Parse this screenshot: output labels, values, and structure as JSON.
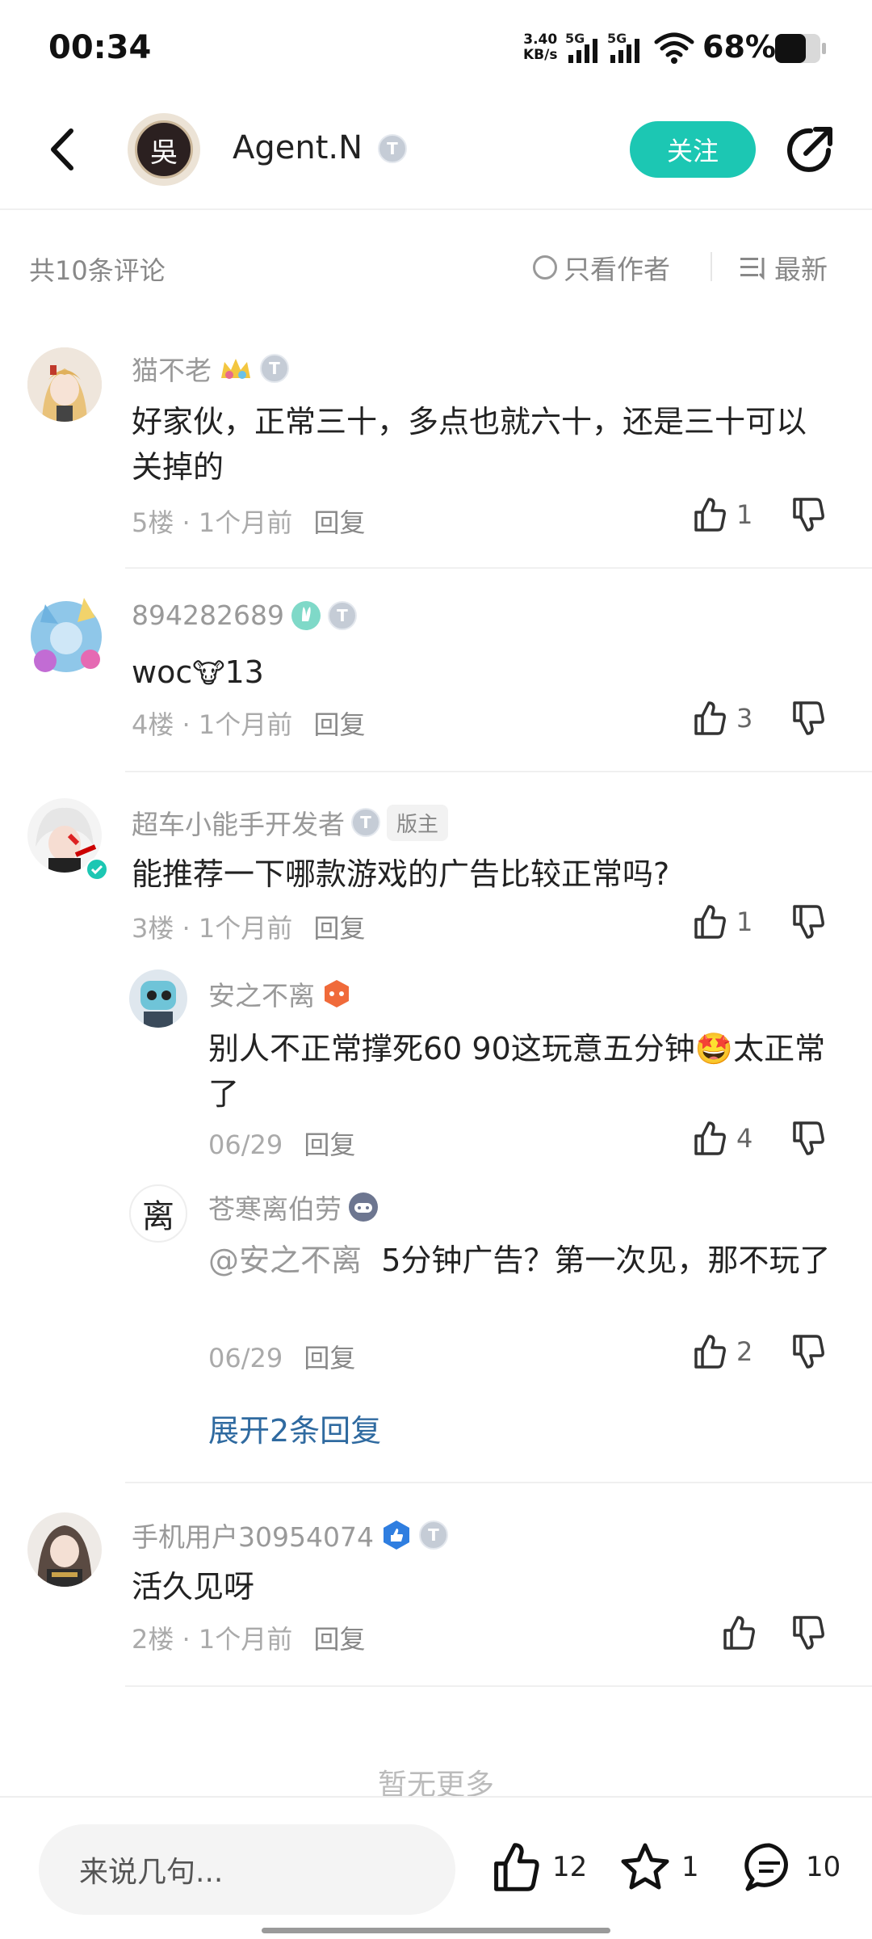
{
  "status_bar": {
    "time": "00:34",
    "net_speed_value": "3.40",
    "net_speed_unit": "KB/s",
    "signal1_label": "5G",
    "signal2_label": "5G",
    "battery": "68%"
  },
  "header": {
    "author_name": "Agent.N",
    "author_avatar_char": "吳",
    "author_level": "T",
    "follow_label": "关注"
  },
  "filter": {
    "count_label": "共10条评论",
    "author_only_label": "只看作者",
    "sort_label": "最新"
  },
  "comments": [
    {
      "name": "猫不老",
      "level": "T",
      "text": "好家伙，正常三十，多点也就六十，还是三十可以关掉的",
      "floor": "5楼",
      "time": "1个月前",
      "reply_label": "回复",
      "likes": "1"
    },
    {
      "name": "894282689",
      "level": "T",
      "text_prefix": "woc",
      "emoji": "🐮",
      "text_suffix": "13",
      "floor": "4楼",
      "time": "1个月前",
      "reply_label": "回复",
      "likes": "3"
    },
    {
      "name": "超车小能手开发者",
      "level": "T",
      "role_badge": "版主",
      "text": "能推荐一下哪款游戏的广告比较正常吗?",
      "floor": "3楼",
      "time": "1个月前",
      "reply_label": "回复",
      "likes": "1",
      "replies": [
        {
          "name": "安之不离",
          "text_part1": "别人不正常撑死60  90这玩意五分钟",
          "emoji": "🤩",
          "text_part2": "太正常了",
          "time": "06/29",
          "reply_label": "回复",
          "likes": "4"
        },
        {
          "name": "苍寒离伯劳",
          "avatar_char": "离",
          "mention": "@安之不离",
          "text": "5分钟广告？第一次见，那不玩了",
          "time": "06/29",
          "reply_label": "回复",
          "likes": "2"
        }
      ],
      "expand_label": "展开2条回复"
    },
    {
      "name": "手机用户30954074",
      "level": "T",
      "text": "活久见呀",
      "floor": "2楼",
      "time": "1个月前",
      "reply_label": "回复",
      "likes": ""
    }
  ],
  "no_more_label": "暂无更多",
  "bottom_bar": {
    "input_placeholder": "来说几句...",
    "like_count": "12",
    "star_count": "1",
    "comment_count": "10"
  },
  "colors": {
    "accent": "#1cc7b3",
    "link": "#2f6aa0",
    "muted": "#999999"
  }
}
